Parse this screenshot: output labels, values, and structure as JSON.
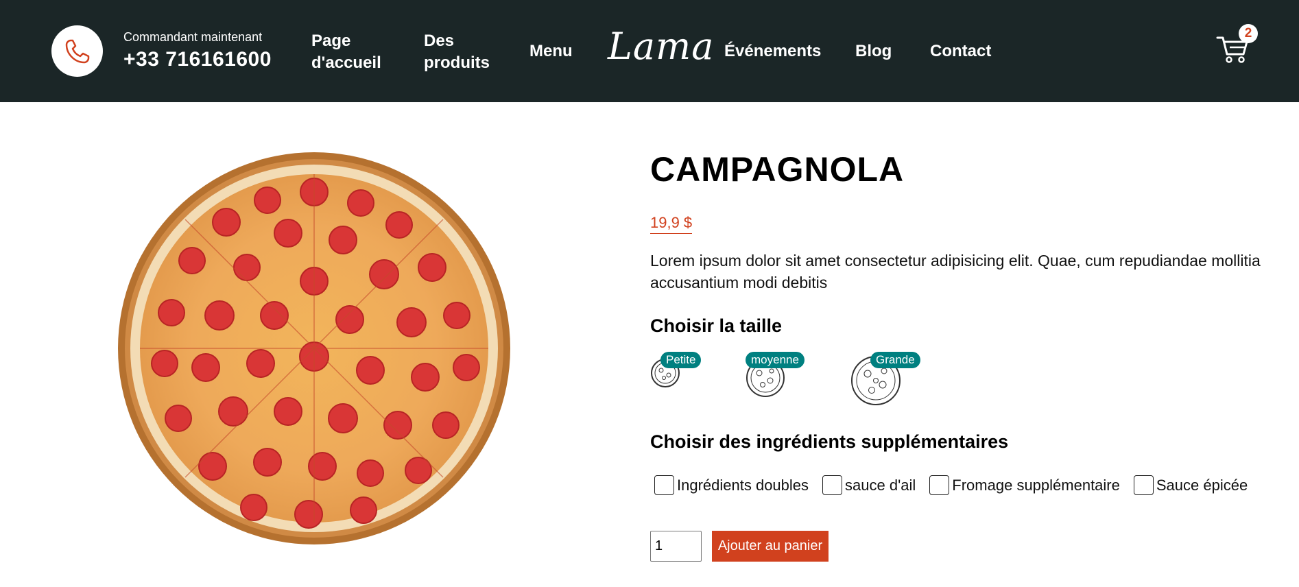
{
  "header": {
    "phone_icon": "phone-icon",
    "order_label": "Commandant maintenant",
    "phone_number": "+33 716161600",
    "nav": {
      "home": "Page d'accueil",
      "products": "Des produits",
      "menu": "Menu",
      "logo": "Lama",
      "events": "Événements",
      "blog": "Blog",
      "contact": "Contact"
    },
    "cart_icon": "cart-icon",
    "cart_count": "2"
  },
  "product": {
    "title": "CAMPAGNOLA",
    "price": "19,9 $",
    "description": "Lorem ipsum dolor sit amet consectetur adipisicing elit. Quae, cum repudiandae mollitia accusantium modi debitis",
    "size_title": "Choisir la taille",
    "sizes": [
      {
        "label": "Petite"
      },
      {
        "label": "moyenne"
      },
      {
        "label": "Grande"
      }
    ],
    "ingredients_title": "Choisir des ingrédients supplémentaires",
    "ingredients": [
      {
        "label": "Ingrédients doubles",
        "checked": false
      },
      {
        "label": "sauce d'ail",
        "checked": false
      },
      {
        "label": "Fromage supplémentaire",
        "checked": false
      },
      {
        "label": "Sauce épicée",
        "checked": false
      }
    ],
    "quantity": "1",
    "add_to_cart": "Ajouter au panier"
  },
  "colors": {
    "header_bg": "#1b2627",
    "accent": "#d1411e",
    "size_badge": "#008080"
  }
}
